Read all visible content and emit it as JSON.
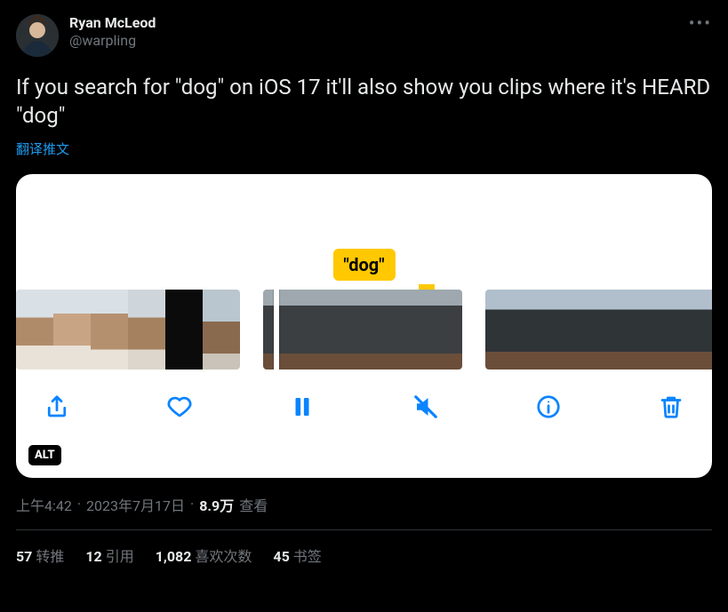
{
  "author": {
    "display_name": "Ryan McLeod",
    "handle": "@warpling"
  },
  "tweet_text": "If you search for \"dog\" on iOS 17 it'll also show you clips where it's HEARD \"dog\"",
  "translate_label": "翻译推文",
  "media": {
    "tag_text": "\"dog\"",
    "alt_badge": "ALT",
    "icons": {
      "share": "share-icon",
      "like": "heart-icon",
      "pause": "pause-icon",
      "mute": "mute-icon",
      "info": "info-icon",
      "trash": "trash-icon"
    }
  },
  "meta": {
    "time": "上午4:42",
    "dot": "·",
    "date": "2023年7月17日",
    "views_count": "8.9万",
    "views_label": "查看"
  },
  "stats": {
    "retweets": {
      "count": "57",
      "label": "转推"
    },
    "quotes": {
      "count": "12",
      "label": "引用"
    },
    "likes": {
      "count": "1,082",
      "label": "喜欢次数"
    },
    "bookmarks": {
      "count": "45",
      "label": "书签"
    }
  },
  "more_icon": "•••"
}
